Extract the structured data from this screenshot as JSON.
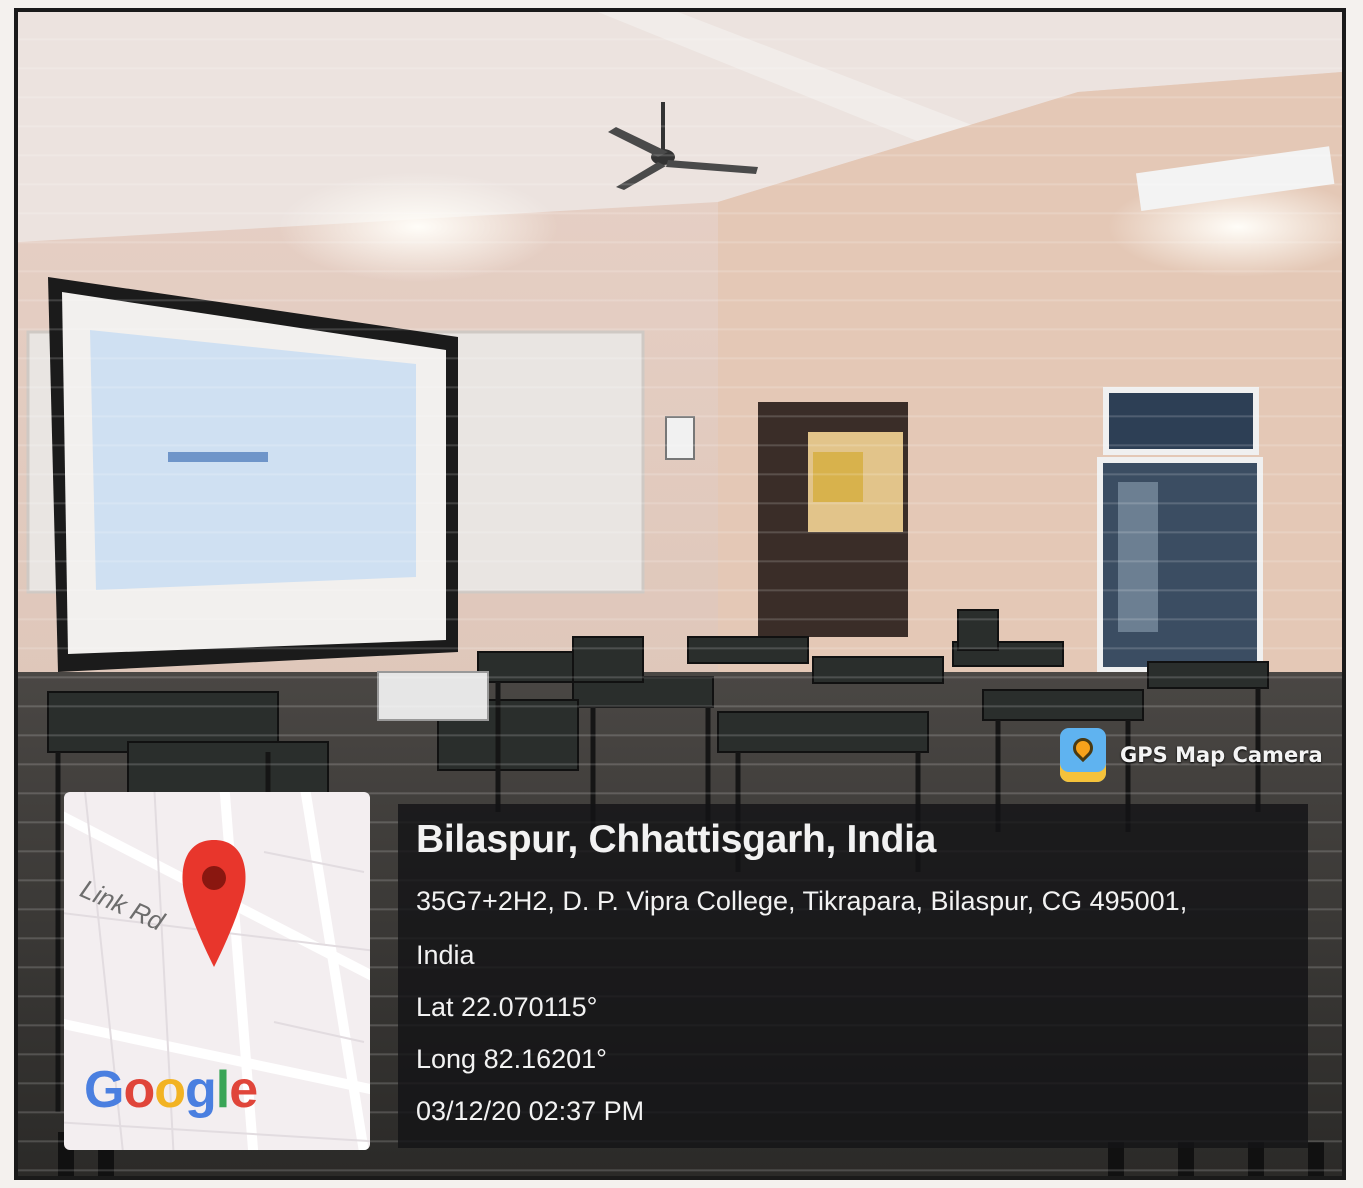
{
  "badge": {
    "icon": "map-pin-camera-icon",
    "label": "GPS Map Camera"
  },
  "location": {
    "place": "Bilaspur, Chhattisgarh, India",
    "address_line1": "35G7+2H2, D. P. Vipra College, Tikrapara, Bilaspur, CG 495001,",
    "address_line2": "India",
    "latitude": "Lat 22.070115°",
    "longitude": "Long 82.16201°",
    "timestamp": "03/12/20 02:37 PM"
  },
  "map": {
    "road_label": "Link Rd",
    "logo_letters": [
      "G",
      "o",
      "o",
      "g",
      "l",
      "e"
    ],
    "pin_icon": "location-pin-icon",
    "pin_color": "#e8362c"
  }
}
